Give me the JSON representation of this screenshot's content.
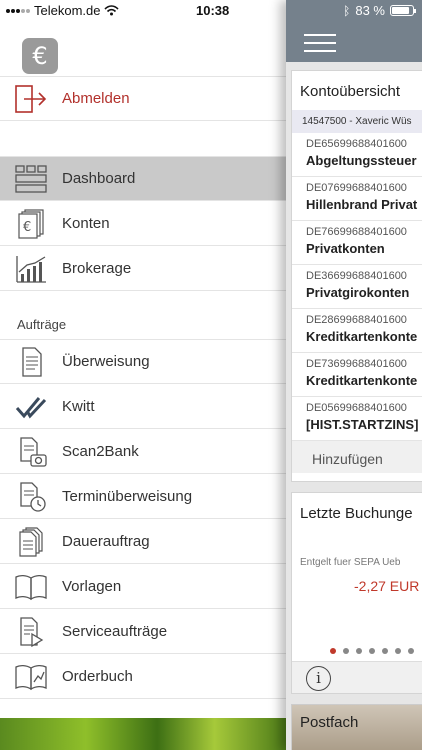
{
  "status_bar": {
    "carrier": "Telekom.de",
    "time": "10:38",
    "battery": "83 %",
    "battery_level": 0.83
  },
  "app": {
    "logo_icon": "euro-chart-logo-icon"
  },
  "menu": {
    "logout_label": "Abmelden",
    "section_label": "Aufträge",
    "items": [
      {
        "label": "Dashboard",
        "icon": "dashboard-grid-icon"
      },
      {
        "label": "Konten",
        "icon": "euro-cards-icon"
      },
      {
        "label": "Brokerage",
        "icon": "bar-chart-icon"
      },
      {
        "label": "Überweisung",
        "icon": "document-icon"
      },
      {
        "label": "Kwitt",
        "icon": "kwitt-check-icon"
      },
      {
        "label": "Scan2Bank",
        "icon": "camera-document-icon"
      },
      {
        "label": "Terminüberweisung",
        "icon": "clock-document-icon"
      },
      {
        "label": "Dauerauftrag",
        "icon": "stacked-documents-icon"
      },
      {
        "label": "Vorlagen",
        "icon": "open-book-icon"
      },
      {
        "label": "Serviceaufträge",
        "icon": "play-document-icon"
      },
      {
        "label": "Orderbuch",
        "icon": "chart-book-icon"
      }
    ]
  },
  "main": {
    "account_card": {
      "title": "Kontoübersicht",
      "header": "14547500 - Xaveric Wüs",
      "accounts": [
        {
          "iban": "DE65699688401600",
          "name": "Abgeltungssteuer"
        },
        {
          "iban": "DE07699688401600",
          "name": "Hillenbrand Privat"
        },
        {
          "iban": "DE76699688401600",
          "name": "Privatkonten"
        },
        {
          "iban": "DE36699688401600",
          "name": "Privatgirokonten"
        },
        {
          "iban": "DE28699688401600",
          "name": "Kreditkartenkonte"
        },
        {
          "iban": "DE73699688401600",
          "name": "Kreditkartenkonte"
        },
        {
          "iban": "DE05699688401600",
          "name": "[HIST.STARTZINS]"
        }
      ],
      "add_label": "Hinzufügen"
    },
    "transactions_card": {
      "title": "Letzte Buchunge",
      "label": "Entgelt fuer SEPA Ueb",
      "amount": "-2,27 EUR",
      "page_count": 7,
      "active_page": 1,
      "amount_color": "#c0392b"
    },
    "postfach_card": {
      "title": "Postfach"
    }
  }
}
